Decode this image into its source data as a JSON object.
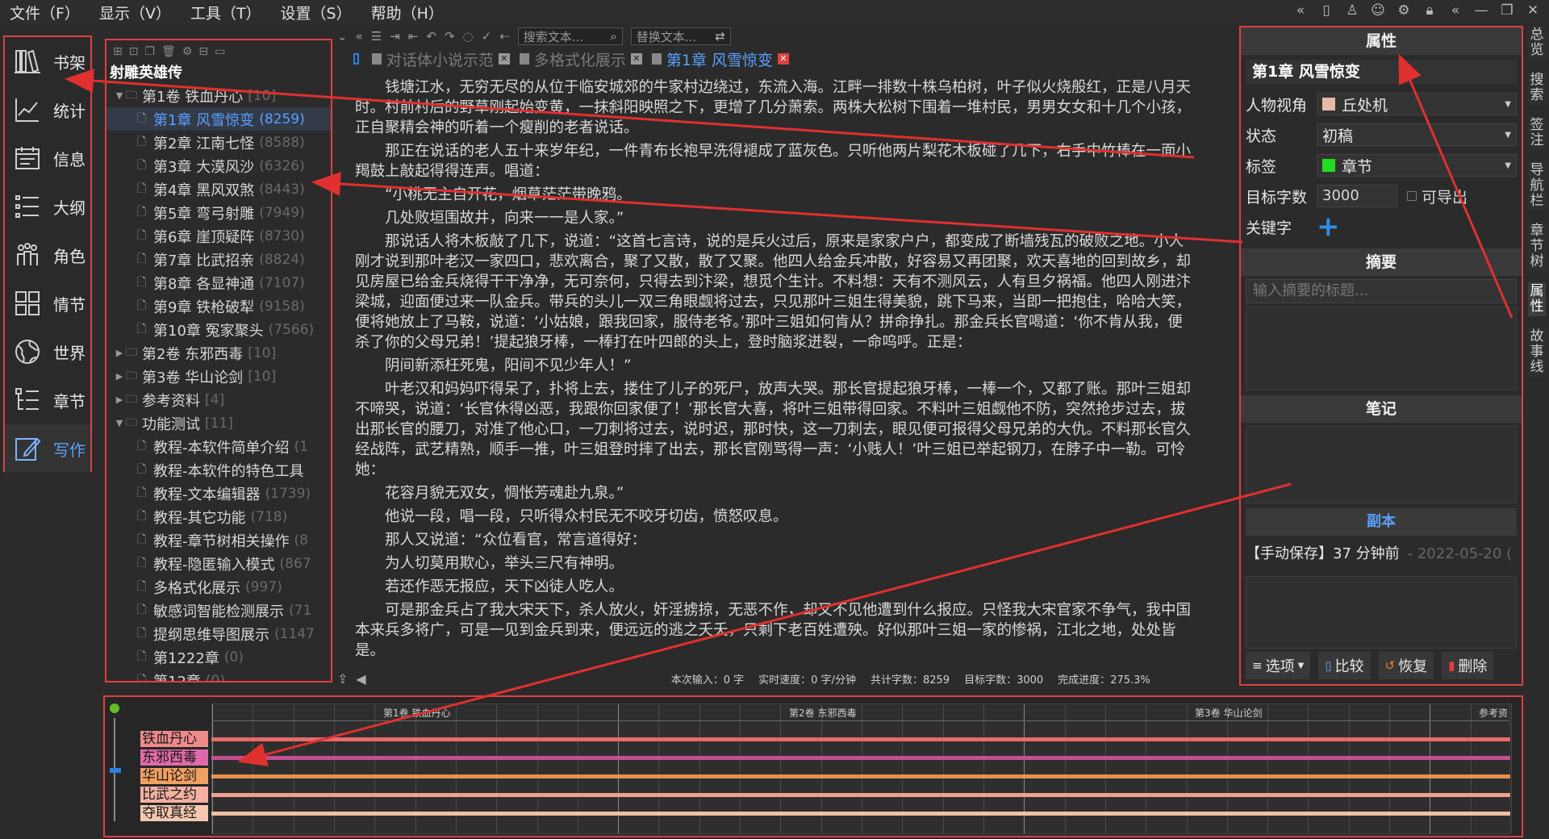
{
  "menu": [
    "文件（F）",
    "显示（V）",
    "工具（T）",
    "设置（S）",
    "帮助（H）"
  ],
  "nav": [
    {
      "label": "书架",
      "icon": "bookshelf-icon"
    },
    {
      "label": "统计",
      "icon": "stats-chart-icon"
    },
    {
      "label": "信息",
      "icon": "calendar-icon"
    },
    {
      "label": "大纲",
      "icon": "outline-list-icon"
    },
    {
      "label": "角色",
      "icon": "characters-icon"
    },
    {
      "label": "情节",
      "icon": "plot-grid-icon"
    },
    {
      "label": "世界",
      "icon": "globe-icon"
    },
    {
      "label": "章节",
      "icon": "chapter-tree-icon"
    },
    {
      "label": "写作",
      "icon": "pencil-icon"
    }
  ],
  "book_title": "射雕英雄传",
  "tree": [
    {
      "kind": "vol",
      "open": true,
      "name": "第1卷 铁血丹心",
      "count": "[10]"
    },
    {
      "kind": "chap",
      "name": "第1章 风雪惊变",
      "count": "(8259)",
      "selected": true
    },
    {
      "kind": "chap",
      "name": "第2章 江南七怪",
      "count": "(8588)"
    },
    {
      "kind": "chap",
      "name": "第3章 大漠风沙",
      "count": "(6326)"
    },
    {
      "kind": "chap",
      "name": "第4章 黑风双煞",
      "count": "(8443)"
    },
    {
      "kind": "chap",
      "name": "第5章 弯弓射雕",
      "count": "(7949)"
    },
    {
      "kind": "chap",
      "name": "第6章 崖顶疑阵",
      "count": "(8730)"
    },
    {
      "kind": "chap",
      "name": "第7章 比武招亲",
      "count": "(8824)"
    },
    {
      "kind": "chap",
      "name": "第8章 各显神通",
      "count": "(7107)"
    },
    {
      "kind": "chap",
      "name": "第9章 铁枪破犁",
      "count": "(9158)"
    },
    {
      "kind": "chap",
      "name": "第10章 冤家聚头",
      "count": "(7566)"
    },
    {
      "kind": "vol",
      "open": false,
      "name": "第2卷 东邪西毒",
      "count": "[10]"
    },
    {
      "kind": "vol",
      "open": false,
      "name": "第3卷 华山论剑",
      "count": "[10]"
    },
    {
      "kind": "vol",
      "open": false,
      "name": "参考资料",
      "count": "[4]"
    },
    {
      "kind": "vol",
      "open": true,
      "name": "功能测试",
      "count": "[11]"
    },
    {
      "kind": "chap",
      "name": "教程-本软件简单介绍",
      "count": "(1"
    },
    {
      "kind": "chap",
      "name": "教程-本软件的特色工具",
      "count": ""
    },
    {
      "kind": "chap",
      "name": "教程-文本编辑器",
      "count": "(1739)"
    },
    {
      "kind": "chap",
      "name": "教程-其它功能",
      "count": "(718)"
    },
    {
      "kind": "chap",
      "name": "教程-章节树相关操作",
      "count": "(8"
    },
    {
      "kind": "chap",
      "name": "教程-隐匿输入模式",
      "count": "(867"
    },
    {
      "kind": "chap",
      "name": "多格式化展示",
      "count": "(997)"
    },
    {
      "kind": "chap",
      "name": "敏感词智能检测展示",
      "count": "(71"
    },
    {
      "kind": "chap",
      "name": "提纲思维导图展示",
      "count": "(1147"
    },
    {
      "kind": "chap",
      "name": "第1222章",
      "count": "(0)"
    },
    {
      "kind": "chap",
      "name": "第12章",
      "count": "(0)"
    }
  ],
  "search": {
    "find_placeholder": "搜索文本...",
    "replace_placeholder": "替换文本..."
  },
  "tabs": [
    {
      "label": "对话体小说示范",
      "active": false
    },
    {
      "label": "多格式化展示",
      "active": false
    },
    {
      "label": "第1章 风雪惊变",
      "active": true
    }
  ],
  "editor_paragraphs": [
    "钱塘江水，无穷无尽的从位于临安城郊的牛家村边绕过，东流入海。江畔一排数十株乌柏树，叶子似火烧般红，正是八月天时。村前村后的野草刚起始变黄，一抹斜阳映照之下，更增了几分萧索。两株大松树下围着一堆村民，男男女女和十几个小孩，正自聚精会神的听着一个瘦削的老者说话。",
    "那正在说话的老人五十来岁年纪，一件青布长袍早洗得褪成了蓝灰色。只听他两片梨花木板碰了几下，右手中竹棒在一面小羯鼓上敲起得得连声。唱道：",
    "“小桃无主自开花，烟草茫茫带晚鸦。",
    "几处败垣围故井，向来一一是人家。”",
    "那说话人将木板敲了几下，说道：“这首七言诗，说的是兵火过后，原来是家家户户，都变成了断墙残瓦的破败之地。小人刚才说到那叶老汉一家四口，悲欢离合，聚了又散，散了又聚。他四人给金兵冲散，好容易又再团聚，欢天喜地的回到故乡，却见房屋已给金兵烧得干干净净，无可奈何，只得去到汴梁，想觅个生计。不料想：天有不测风云，人有旦夕祸福。他四人刚进汴梁城，迎面便过来一队金兵。带兵的头儿一双三角眼觑将过去，只见那叶三姐生得美貌，跳下马来，当即一把抱住，哈哈大笑，便将她放上了马鞍，说道：‘小姑娘，跟我回家，服侍老爷。’那叶三姐如何肯从？拼命挣扎。那金兵长官喝道：‘你不肯从我，便杀了你的父母兄弟！’提起狼牙棒，一棒打在叶四郎的头上，登时脑浆迸裂，一命呜呼。正是：",
    "阴间新添枉死鬼，阳间不见少年人！”",
    "叶老汉和妈妈吓得呆了，扑将上去，搂住了儿子的死尸，放声大哭。那长官提起狼牙棒，一棒一个，又都了账。那叶三姐却不啼哭，说道：‘长官休得凶恶，我跟你回家便了！’那长官大喜，将叶三姐带得回家。不料叶三姐觑他不防，突然抢步过去，拔出那长官的腰刀，对准了他心口，一刀刺将过去，说时迟，那时快，这一刀刺去，眼见便可报得父母兄弟的大仇。不料那长官久经战阵，武艺精熟，顺手一推，叶三姐登时摔了出去，那长官刚骂得一声：‘小贱人！’叶三姐已举起钢刀，在脖子中一勒。可怜她：",
    "花容月貌无双女，惆怅芳魂赴九泉。”",
    "他说一段，唱一段，只听得众村民无不咬牙切齿，愤怒叹息。",
    "那人又说道：“众位看官，常言道得好：",
    "为人切莫用欺心，举头三尺有神明。",
    "若还作恶无报应，天下凶徒人吃人。",
    "可是那金兵占了我大宋天下，杀人放火，奸淫掳掠，无恶不作，却又不见他遭到什么报应。只怪我大宋官家不争气，我中国本来兵多将广，可是一见到金兵到来，便远远的逃之夭夭，只剩下老百姓遭殃。好似那叶三姐一家的惨祸，江北之地，处处皆是。"
  ],
  "status": {
    "session_input_label": "本次输入：",
    "session_input_value": "0 字",
    "speed_label": "实时速度：",
    "speed_value": "0 字/分钟",
    "total_label": "共计字数：",
    "total_value": "8259",
    "target_label": "目标字数：",
    "target_value": "3000",
    "progress_label": "完成进度：",
    "progress_value": "275.3%"
  },
  "props": {
    "header": "属性",
    "title": "第1章 风雪惊变",
    "pov_label": "人物视角",
    "pov_value": "丘处机",
    "pov_color": "#e8b8a8",
    "state_label": "状态",
    "state_value": "初稿",
    "tag_label": "标签",
    "tag_value": "章节",
    "tag_color": "#22dd22",
    "target_label": "目标字数",
    "target_value": "3000",
    "exportable_label": "可导出",
    "keyword_label": "关键字",
    "summary_header": "摘要",
    "summary_placeholder": "输入摘要的标题...",
    "notes_header": "笔记",
    "copy_header": "副本",
    "copy_item": "【手动保存】37 分钟前",
    "copy_date": "- 2022-05-20 (",
    "buttons": [
      "选项",
      "比较",
      "恢复",
      "删除"
    ]
  },
  "right_tabs": [
    "总览",
    "搜索",
    "签注",
    "导航栏",
    "章节树",
    "属性",
    "故事线"
  ],
  "timeline": {
    "volumes": [
      "第1卷 铁血丹心",
      "第2卷 东邪西毒",
      "第3卷 华山论剑",
      "参考资"
    ],
    "plots": [
      {
        "name": "铁血丹心",
        "color": "#f08a8a",
        "line": "#e86a6a"
      },
      {
        "name": "东邪西毒",
        "color": "#e06aa8",
        "line": "#c25090"
      },
      {
        "name": "华山论剑",
        "color": "#f0a060",
        "line": "#e89050"
      },
      {
        "name": "比武之约",
        "color": "#f4b0a0",
        "line": "#f0a090"
      },
      {
        "name": "夺取真经",
        "color": "#f4c8b0",
        "line": "#f0c0a8"
      }
    ]
  }
}
